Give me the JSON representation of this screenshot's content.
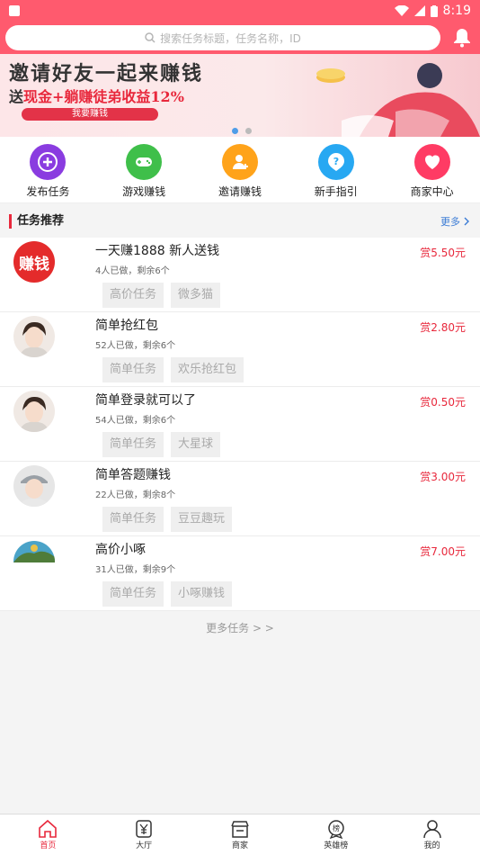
{
  "status": {
    "time": "8:19"
  },
  "search": {
    "placeholder": "搜索任务标题，任务名称，ID"
  },
  "banner": {
    "line1": "邀请好友一起来赚钱",
    "line2_prefix": "送",
    "line2_highlight": "现金+躺赚徒弟收益12%",
    "button": "我要赚钱"
  },
  "quick": [
    {
      "label": "发布任务",
      "icon": "plus-icon",
      "color": "#8a3ce0"
    },
    {
      "label": "游戏赚钱",
      "icon": "gamepad-icon",
      "color": "#3fbf4a"
    },
    {
      "label": "邀请赚钱",
      "icon": "user-add-icon",
      "color": "#ffa31a"
    },
    {
      "label": "新手指引",
      "icon": "help-icon",
      "color": "#27a8f2"
    },
    {
      "label": "商家中心",
      "icon": "heart-icon",
      "color": "#ff3b64"
    }
  ],
  "section": {
    "title": "任务推荐",
    "more": "更多"
  },
  "tasks": [
    {
      "title": "一天赚1888 新人送钱",
      "meta": "4人已做，剩余6个",
      "reward": "赏5.50元",
      "tags": [
        "高价任务",
        "微多猫"
      ],
      "avatar_text": "赚钱"
    },
    {
      "title": "简单抢红包",
      "meta": "52人已做，剩余6个",
      "reward": "赏2.80元",
      "tags": [
        "简单任务",
        "欢乐抢红包"
      ]
    },
    {
      "title": "简单登录就可以了",
      "meta": "54人已做，剩余6个",
      "reward": "赏0.50元",
      "tags": [
        "简单任务",
        "大星球"
      ]
    },
    {
      "title": "简单答题赚钱",
      "meta": "22人已做，剩余8个",
      "reward": "赏3.00元",
      "tags": [
        "简单任务",
        "豆豆趣玩"
      ]
    },
    {
      "title": "高价小啄",
      "meta": "31人已做，剩余9个",
      "reward": "赏7.00元",
      "tags": [
        "简单任务",
        "小啄赚钱"
      ]
    }
  ],
  "more_tasks": "更多任务 > >",
  "tabs": [
    {
      "label": "首页",
      "icon": "home-icon"
    },
    {
      "label": "大厅",
      "icon": "yen-icon"
    },
    {
      "label": "商家",
      "icon": "shop-icon"
    },
    {
      "label": "英雄榜",
      "icon": "rank-icon"
    },
    {
      "label": "我的",
      "icon": "person-icon"
    }
  ]
}
